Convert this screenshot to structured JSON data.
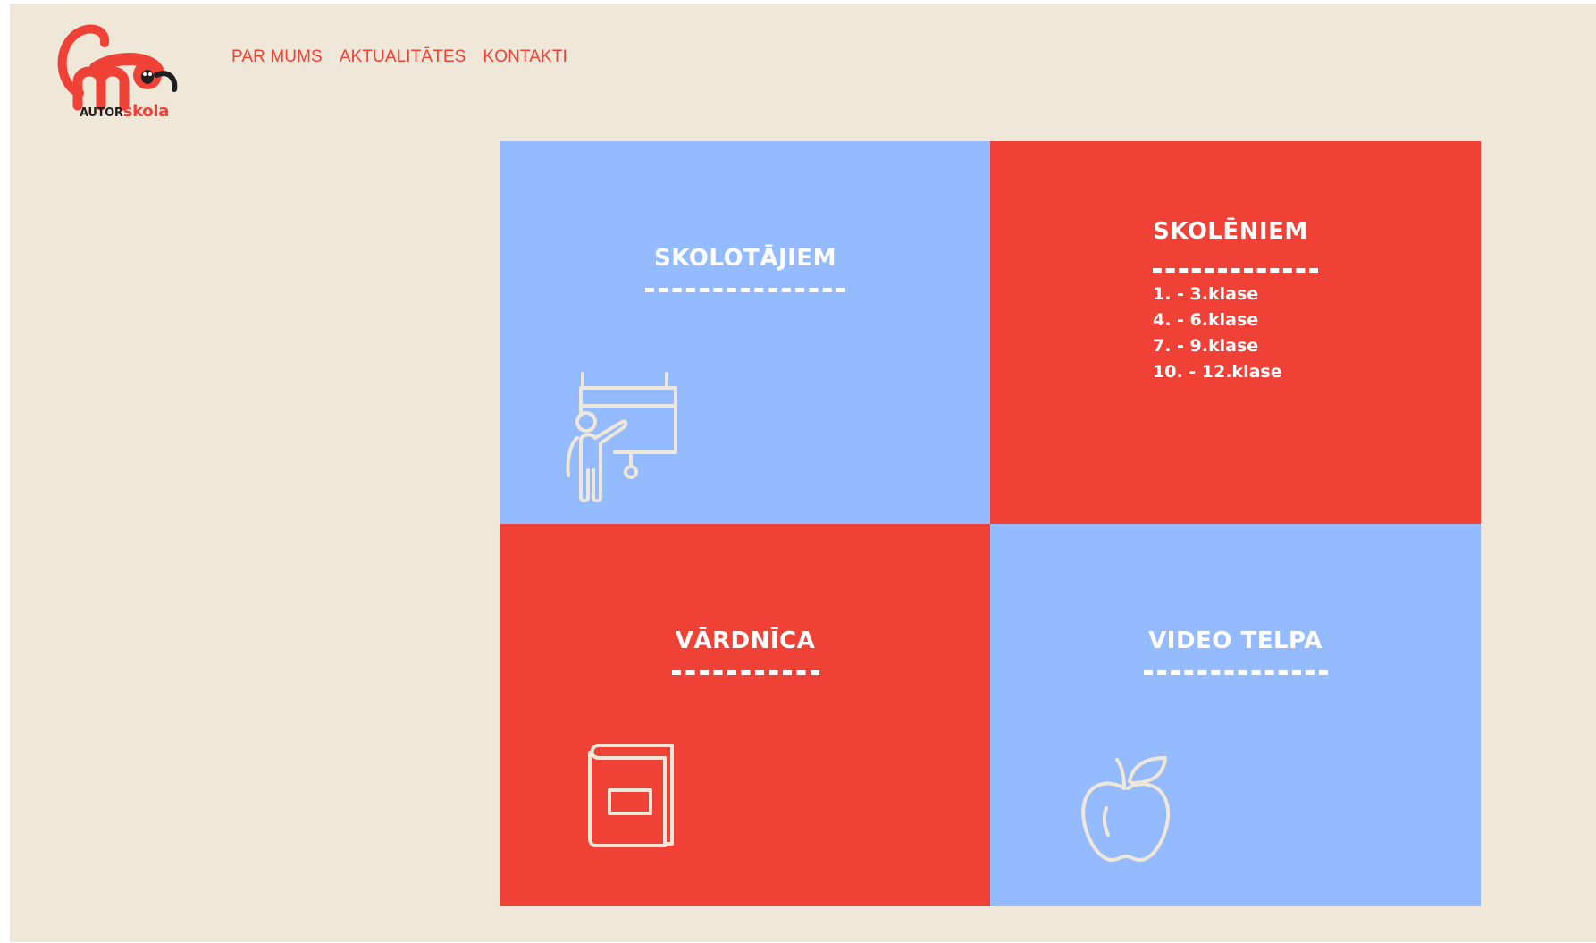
{
  "logo": {
    "text_part1": "AUTOR",
    "text_part2": "skola",
    "icon": "monkey-logo-icon"
  },
  "nav": {
    "items": [
      {
        "label": "PAR MUMS"
      },
      {
        "label": "AKTUALITĀTES"
      },
      {
        "label": "KONTAKTI"
      }
    ]
  },
  "tiles": {
    "teachers": {
      "title": "SKOLOTĀJIEM",
      "icon": "teacher-board-icon",
      "color": "#94baff"
    },
    "students": {
      "title": "SKOLĒNIEM",
      "color": "#ef4136",
      "links": [
        {
          "label": "1. - 3.klase"
        },
        {
          "label": "4. - 6.klase"
        },
        {
          "label": "7. - 9.klase"
        },
        {
          "label": "10. - 12.klase"
        }
      ]
    },
    "dictionary": {
      "title": "VĀRDNĪCA",
      "icon": "book-icon",
      "color": "#ef4136"
    },
    "video": {
      "title": "VIDEO TELPA",
      "icon": "apple-icon",
      "color": "#94baff"
    }
  },
  "colors": {
    "background": "#efe7d8",
    "accent_red": "#ef4136",
    "accent_blue": "#94baff"
  }
}
